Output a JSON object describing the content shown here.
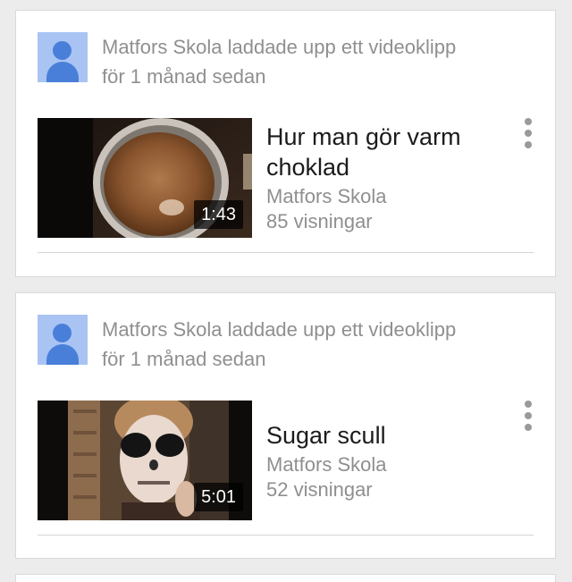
{
  "feed": {
    "items": [
      {
        "activity": "Matfors Skola laddade upp ett videoklipp för 1 månad sedan",
        "title": "Hur man gör varm choklad",
        "channel": "Matfors Skola",
        "views": "85 visningar",
        "duration": "1:43",
        "thumbnail_subject": "hot chocolate in a saucepan"
      },
      {
        "activity": "Matfors Skola laddade upp ett videoklipp för 1 månad sedan",
        "title": "Sugar scull",
        "channel": "Matfors Skola",
        "views": "52 visningar",
        "duration": "5:01",
        "thumbnail_subject": "face painted as a sugar skull"
      }
    ]
  },
  "icons": {
    "avatar": "default-user-avatar-icon",
    "menu": "more-vertical-icon"
  },
  "colors": {
    "avatar_bg": "#a9c4f3",
    "avatar_fg": "#4a7fd9",
    "text_primary": "#1b1b1b",
    "text_secondary": "#8f8f8f",
    "page_bg": "#ececec"
  }
}
